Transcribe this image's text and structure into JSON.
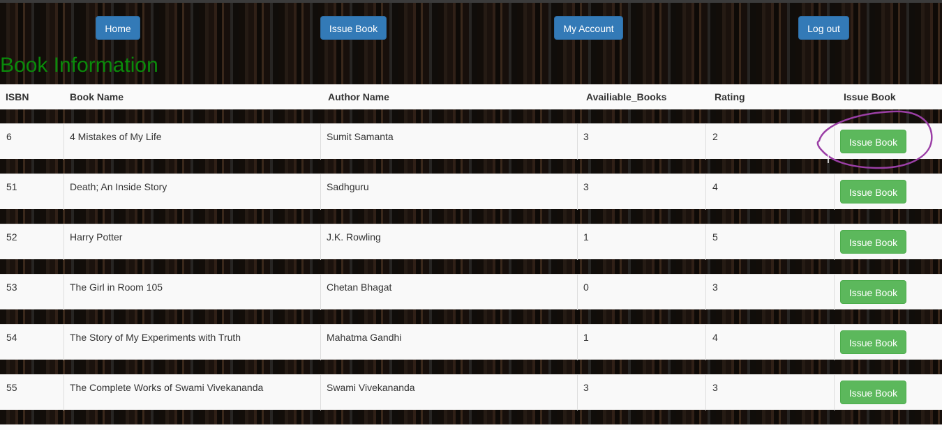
{
  "nav": {
    "home_label": "Home",
    "issue_label": "Issue Book",
    "account_label": "My Account",
    "logout_label": "Log out"
  },
  "page_title": "Book Information",
  "table": {
    "headers": [
      "ISBN",
      "Book Name",
      "Author Name",
      "Availiable_Books",
      "Rating",
      "Issue Book"
    ],
    "rows": [
      {
        "isbn": "6",
        "name": "4 Mistakes of My Life",
        "author": "Sumit Samanta",
        "available": "3",
        "rating": "2",
        "action": "Issue Book"
      },
      {
        "isbn": "51",
        "name": "Death; An Inside Story",
        "author": "Sadhguru",
        "available": "3",
        "rating": "4",
        "action": "Issue Book"
      },
      {
        "isbn": "52",
        "name": "Harry Potter",
        "author": "J.K. Rowling",
        "available": "1",
        "rating": "5",
        "action": "Issue Book"
      },
      {
        "isbn": "53",
        "name": "The Girl in Room 105",
        "author": "Chetan Bhagat",
        "available": "0",
        "rating": "3",
        "action": "Issue Book"
      },
      {
        "isbn": "54",
        "name": "The Story of My Experiments with Truth",
        "author": "Mahatma Gandhi",
        "available": "1",
        "rating": "4",
        "action": "Issue Book"
      },
      {
        "isbn": "55",
        "name": "The Complete Works of Swami Vivekananda",
        "author": "Swami Vivekananda",
        "available": "3",
        "rating": "3",
        "action": "Issue Book"
      }
    ]
  },
  "colors": {
    "nav_button": "#337ab7",
    "issue_button": "#5cb85c",
    "title": "#0a8a0a",
    "annotation": "#9b3fa6"
  }
}
